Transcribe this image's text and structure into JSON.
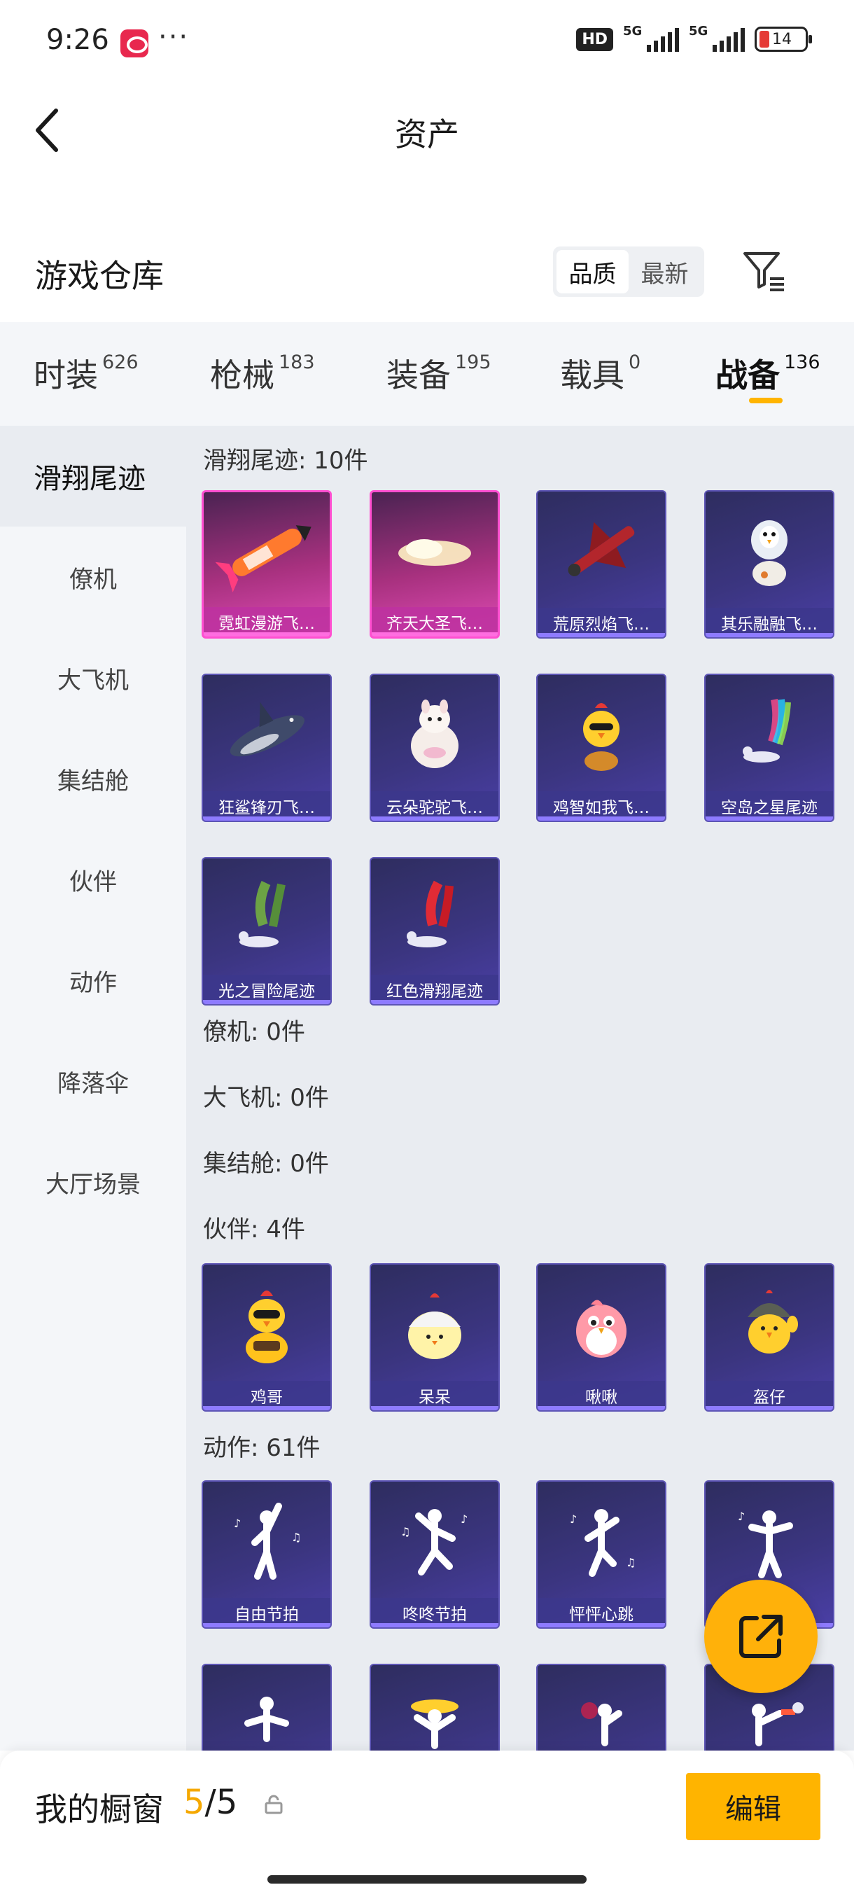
{
  "status_bar": {
    "time": "9:26",
    "more": "···",
    "hd": "HD",
    "net1": "5G",
    "net2": "5G",
    "battery": "14"
  },
  "header": {
    "title": "资产",
    "back_icon": "chevron-left-icon"
  },
  "warehouse": {
    "title": "游戏仓库",
    "sort_options": [
      "品质",
      "最新"
    ],
    "active_sort": "品质",
    "filter_icon": "filter-icon"
  },
  "categories": [
    {
      "name": "时装",
      "count": "626"
    },
    {
      "name": "枪械",
      "count": "183"
    },
    {
      "name": "装备",
      "count": "195"
    },
    {
      "name": "载具",
      "count": "0"
    },
    {
      "name": "战备",
      "count": "136"
    }
  ],
  "active_category": "战备",
  "side_nav": [
    "滑翔尾迹",
    "僚机",
    "大飞机",
    "集结舱",
    "伙伴",
    "动作",
    "降落伞",
    "大厅场景"
  ],
  "active_side_nav": "滑翔尾迹",
  "sections": {
    "glide": {
      "label": "滑翔尾迹: 10件",
      "items": [
        "霓虹漫游飞…",
        "齐天大圣飞…",
        "荒原烈焰飞…",
        "其乐融融飞…",
        "狂鲨锋刃飞…",
        "云朵驼驼飞…",
        "鸡智如我飞…",
        "空岛之星尾迹",
        "光之冒险尾迹",
        "红色滑翔尾迹"
      ]
    },
    "wingman": {
      "label": "僚机: 0件"
    },
    "plane": {
      "label": "大飞机: 0件"
    },
    "pod": {
      "label": "集结舱: 0件"
    },
    "partner": {
      "label": "伙伴: 4件",
      "items": [
        "鸡哥",
        "呆呆",
        "啾啾",
        "盔仔"
      ]
    },
    "emote": {
      "label": "动作: 61件",
      "items": [
        "自由节拍",
        "咚咚节拍",
        "怦怦心跳"
      ]
    }
  },
  "showcase": {
    "title": "我的橱窗",
    "current": "5",
    "total": "/5",
    "edit_label": "编辑"
  },
  "colors": {
    "accent": "#ffb400",
    "card_purple": "#3b3580",
    "card_pink": "#e04cb7"
  }
}
